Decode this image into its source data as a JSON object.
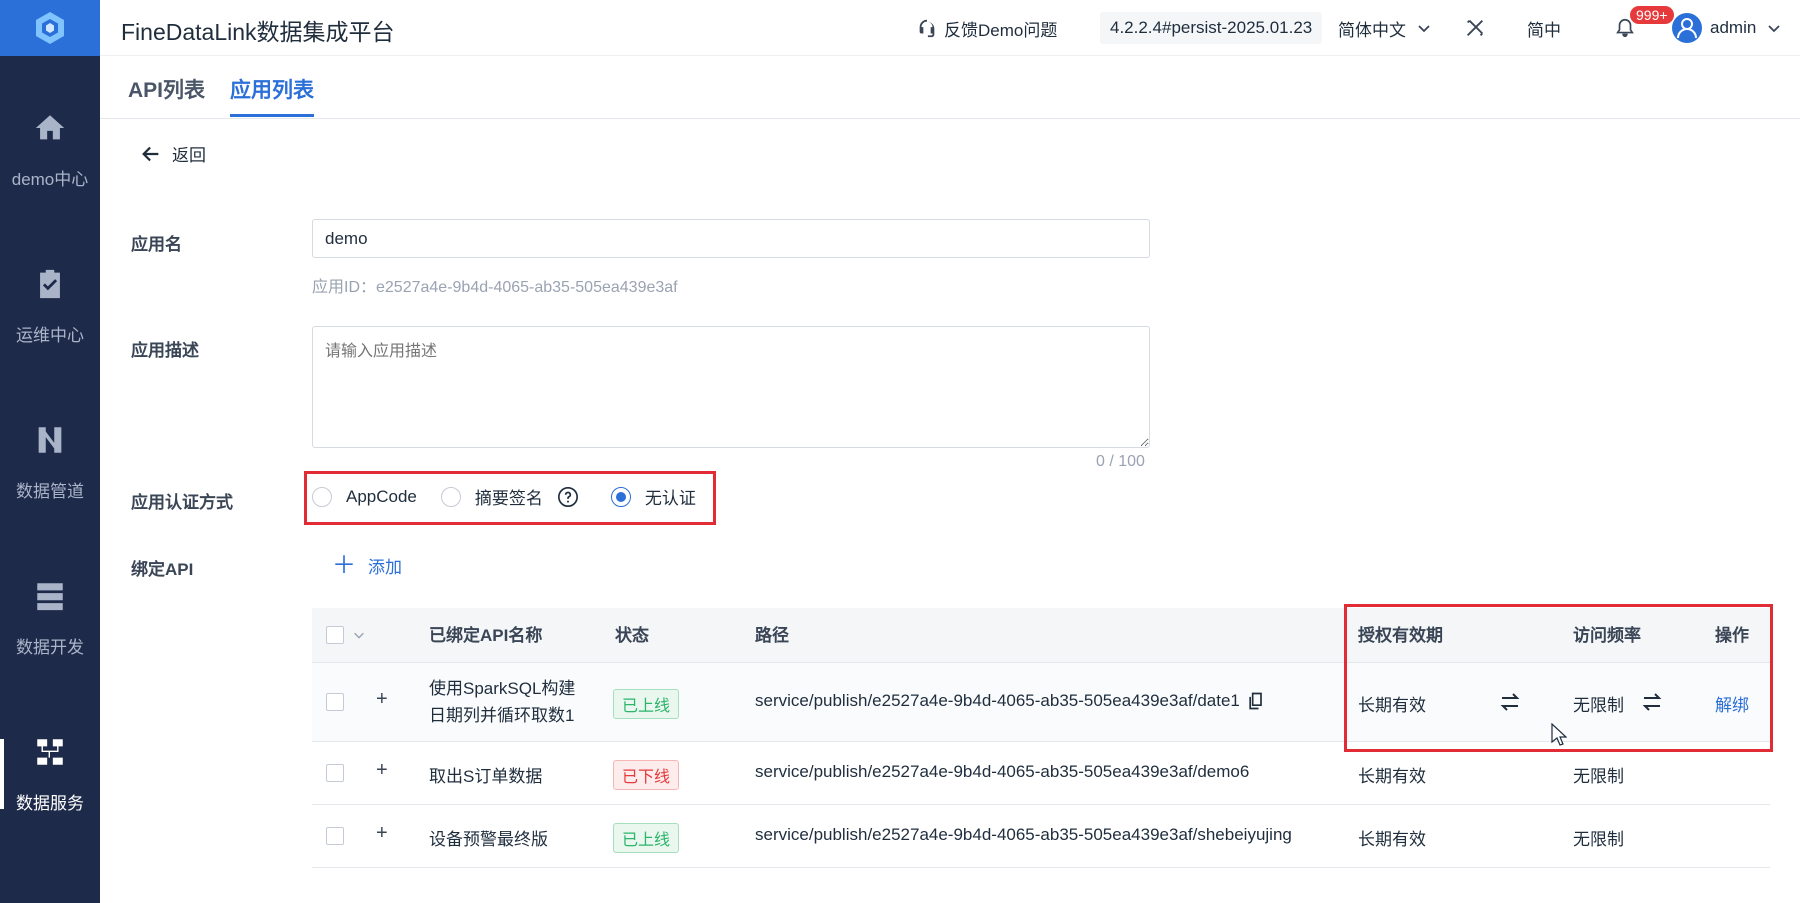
{
  "app": {
    "title": "FineDataLink数据集成平台"
  },
  "sidebar": {
    "items": [
      {
        "label": "demo中心",
        "icon": "home-icon"
      },
      {
        "label": "运维中心",
        "icon": "clipboard-check-icon"
      },
      {
        "label": "数据管道",
        "icon": "pipeline-icon"
      },
      {
        "label": "数据开发",
        "icon": "server-stack-icon"
      },
      {
        "label": "数据服务",
        "icon": "data-service-icon"
      }
    ]
  },
  "header": {
    "feedback_label": "反馈Demo问题",
    "version": "4.2.2.4#persist-2025.01.23",
    "language": "简体中文",
    "lang_short": "简中",
    "notification_count": "999+",
    "user": "admin"
  },
  "tabs": [
    {
      "label": "API列表",
      "active": false
    },
    {
      "label": "应用列表",
      "active": true
    }
  ],
  "back_label": "返回",
  "form": {
    "app_name_label": "应用名",
    "app_name_value": "demo",
    "app_id_text": "应用ID：e2527a4e-9b4d-4065-ab35-505ea439e3af",
    "desc_label": "应用描述",
    "desc_placeholder": "请输入应用描述",
    "desc_counter": "0 / 100",
    "auth_label": "应用认证方式",
    "auth_options": [
      "AppCode",
      "摘要签名",
      "无认证"
    ],
    "auth_selected": "无认证",
    "bind_label": "绑定API",
    "add_label": "添加"
  },
  "table": {
    "headers": {
      "name": "已绑定API名称",
      "status": "状态",
      "path": "路径",
      "validity": "授权有效期",
      "frequency": "访问频率",
      "action": "操作"
    },
    "rows": [
      {
        "name_line1": "使用SparkSQL构建",
        "name_line2": "日期列并循环取数1",
        "status": "已上线",
        "path": "service/publish/e2527a4e-9b4d-4065-ab35-505ea439e3af/date1",
        "validity": "长期有效",
        "frequency": "无限制",
        "action": "解绑"
      },
      {
        "name": "取出S订单数据",
        "status": "已下线",
        "path": "service/publish/e2527a4e-9b4d-4065-ab35-505ea439e3af/demo6",
        "validity": "长期有效",
        "frequency": "无限制"
      },
      {
        "name": "设备预警最终版",
        "status": "已上线",
        "path": "service/publish/e2527a4e-9b4d-4065-ab35-505ea439e3af/shebeiyujing",
        "validity": "长期有效",
        "frequency": "无限制"
      }
    ]
  },
  "colors": {
    "sidebar_bg": "#1e2a4a",
    "accent": "#2b6fd8",
    "highlight_red": "#e12c36",
    "online_green": "#2bb46a",
    "offline_red": "#e5393b"
  }
}
